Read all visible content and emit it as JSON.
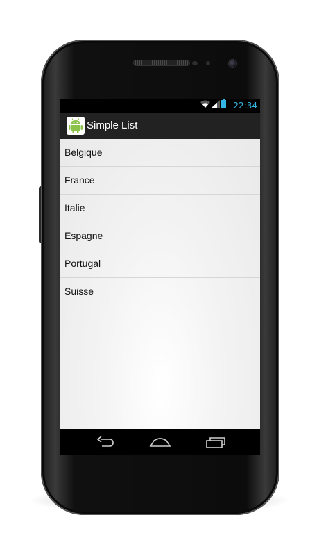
{
  "status_bar": {
    "time": "22:34",
    "icons": [
      "wifi-icon",
      "signal-icon",
      "battery-icon"
    ],
    "time_color": "#33b5e5"
  },
  "action_bar": {
    "icon": "android-app-icon",
    "title": "Simple List",
    "background": "#222222"
  },
  "list": {
    "items": [
      {
        "label": "Belgique"
      },
      {
        "label": "France"
      },
      {
        "label": "Italie"
      },
      {
        "label": "Espagne"
      },
      {
        "label": "Portugal"
      },
      {
        "label": "Suisse"
      }
    ]
  },
  "nav_bar": {
    "buttons": [
      "back-icon",
      "home-icon",
      "recent-apps-icon"
    ]
  }
}
